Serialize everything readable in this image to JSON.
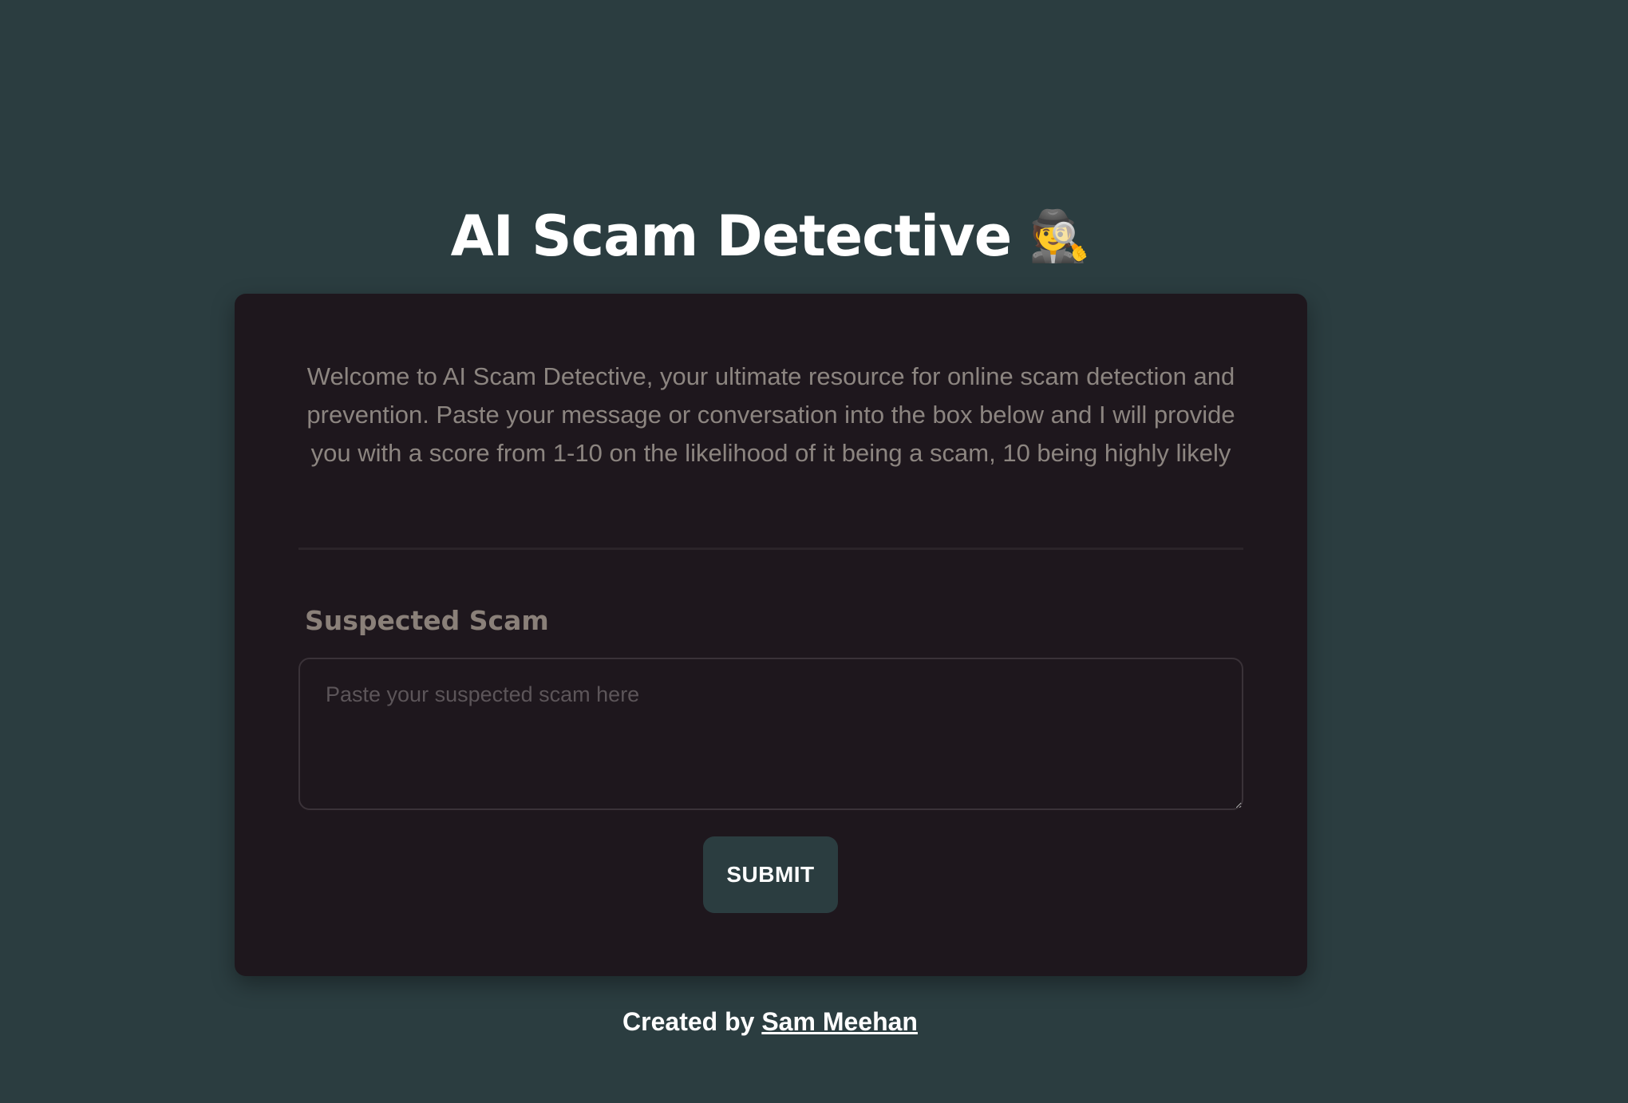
{
  "header": {
    "title": "AI Scam Detective",
    "title_icon": "🕵️",
    "title_icon_name": "detective-icon"
  },
  "intro": {
    "text": "Welcome to AI Scam Detective, your ultimate resource for online scam detection and prevention. Paste your message or conversation into the box below and I will provide you with a score from 1-10 on the likelihood of it being a scam, 10 being highly likely"
  },
  "form": {
    "label": "Suspected Scam",
    "input_value": "",
    "input_placeholder": "Paste your suspected scam here",
    "submit_label": "SUBMIT"
  },
  "footer": {
    "prefix": "Created by",
    "author": "Sam Meehan"
  },
  "colors": {
    "page_background": "#2b3d40",
    "card_background": "#1e171d",
    "button_background": "#2b3d40",
    "muted_text": "#8c8580"
  }
}
